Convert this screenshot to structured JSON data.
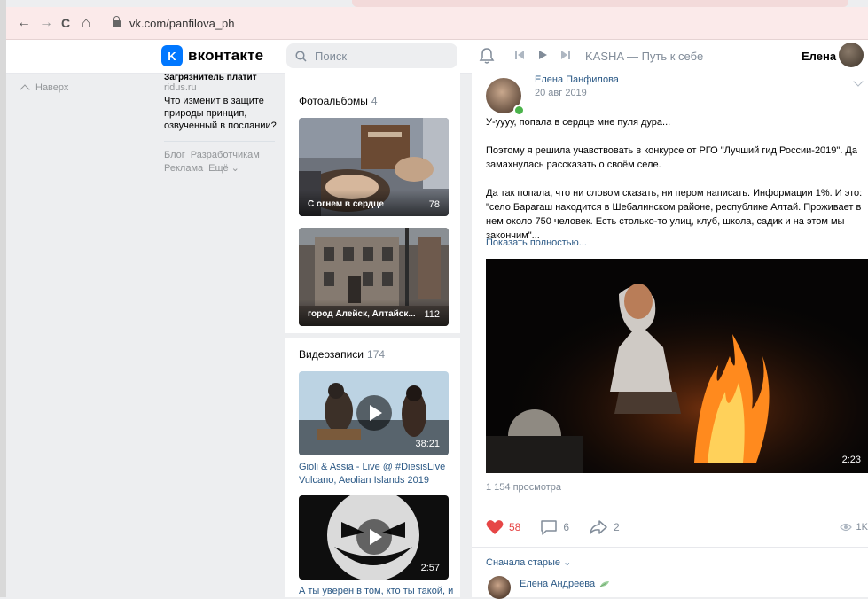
{
  "browser": {
    "url": "vk.com/panfilova_ph",
    "nav": {
      "back": "←",
      "forward": "→",
      "reload": "C",
      "home": "⌂"
    }
  },
  "header": {
    "logo_letter": "K",
    "logo_text": "вконтакте",
    "search_placeholder": "Поиск",
    "track": "KASHA — Путь к себе",
    "user_name": "Елена"
  },
  "left": {
    "up_link": "Наверх",
    "ad": {
      "title": "Загрязнитель платит",
      "source": "ridus.ru",
      "text": "Что изменит в защите природы принцип, озвученный в послании?"
    },
    "footer": {
      "blog": "Блог",
      "developers": "Разработчикам",
      "ads": "Реклама",
      "more": "Ещё ⌄"
    }
  },
  "albums": {
    "title": "Фотоальбомы",
    "count": "4",
    "items": [
      {
        "name": "С огнем в сердце",
        "count": "78"
      },
      {
        "name": "город Алейск, Алтайск...",
        "count": "112"
      }
    ]
  },
  "videos": {
    "title": "Видеозаписи",
    "count": "174",
    "items": [
      {
        "duration": "38:21",
        "title": "Gioli & Assia - Live @ #DiesisLive Vulcano, Aeolian Islands 2019"
      },
      {
        "duration": "2:57",
        "title": "А ты уверен в том, кто ты такой, и"
      }
    ]
  },
  "post": {
    "author": "Елена Панфилова",
    "date": "20 авг 2019",
    "paragraphs": [
      "У-уууу, попала в сердце мне пуля дура...",
      "Поэтому я решила учавствовать в конкурсе от РГО \"Лучший гид России-2019\". Да замахнулась рассказать о своём селе.",
      "Да так попала, что ни словом сказать, ни пером написать. Информации 1%. И это: \"село Барагаш находится в Шебалинском районе, республике Алтай. Проживает в нем около 750 человек. Есть столько-то улиц, клуб, школа, садик и на этом мы закончим\"..."
    ],
    "show_more": "Показать полностью...",
    "video_duration": "2:23",
    "video_views": "1 154 просмотра",
    "likes": "58",
    "comments": "6",
    "shares": "2",
    "views": "1K",
    "sort_label": "Сначала старые ⌄",
    "first_comment_author": "Елена Андреева",
    "colors": {
      "accent": "#2a5885",
      "like": "#e64646",
      "brand": "#0077ff"
    }
  }
}
